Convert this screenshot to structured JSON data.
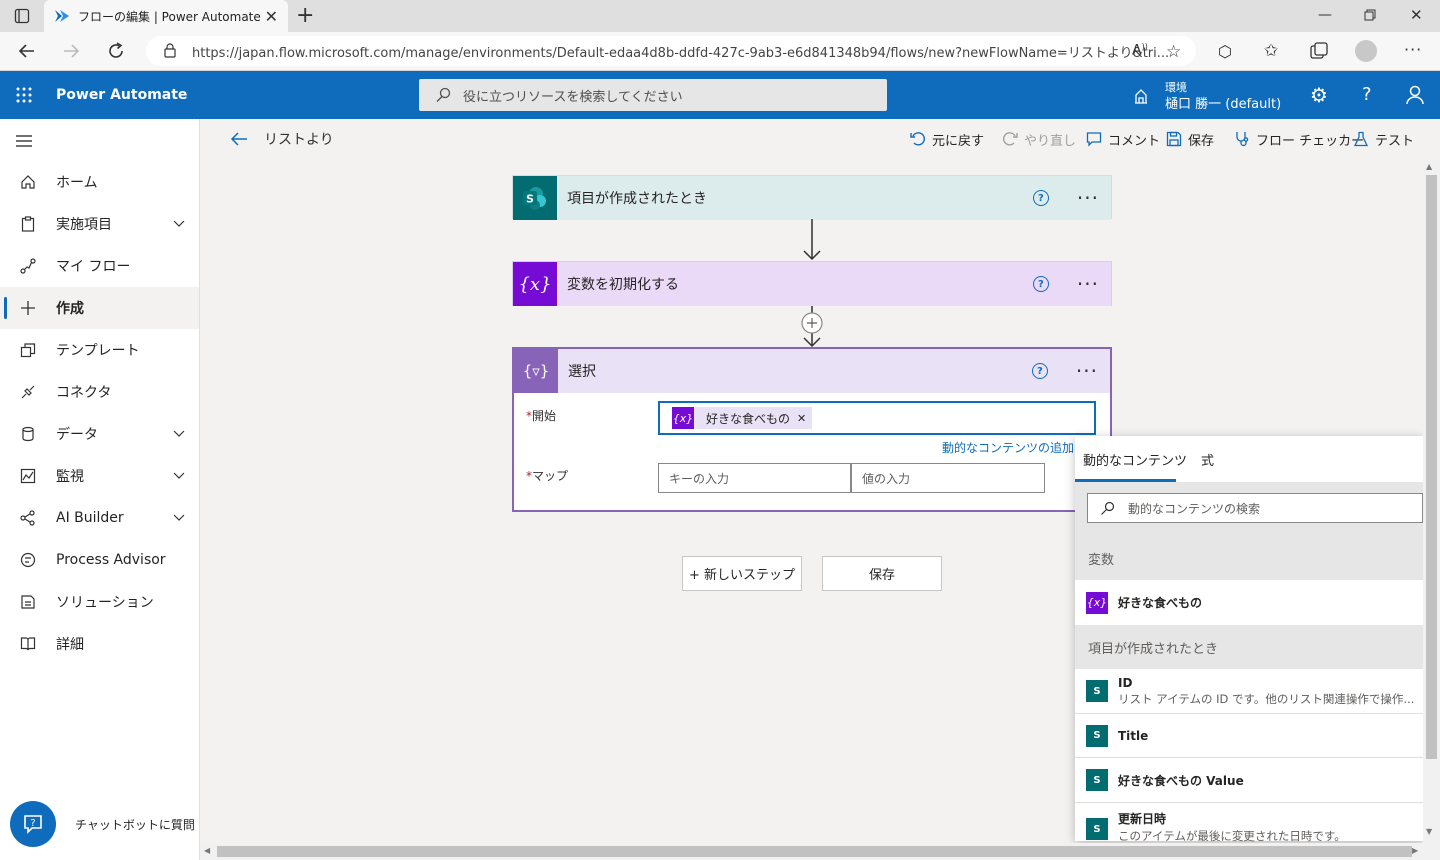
{
  "browser": {
    "tab_title": "フローの編集 | Power Automate",
    "url": "https://japan.flow.microsoft.com/manage/environments/Default-edaa4d8b-ddfd-427c-9ab3-e6d841348b94/flows/new?newFlowName=リストより&tri..."
  },
  "app": {
    "title": "Power Automate",
    "search_placeholder": "役に立つリソースを検索してください",
    "env_label": "環境",
    "env_name": "樋口 勝一 (default)"
  },
  "sidebar": {
    "items": [
      {
        "label": "ホーム",
        "icon": "home-icon"
      },
      {
        "label": "実施項目",
        "icon": "clipboard-icon",
        "chevron": true
      },
      {
        "label": "マイ フロー",
        "icon": "flow-icon"
      },
      {
        "label": "作成",
        "icon": "plus-icon",
        "active": true
      },
      {
        "label": "テンプレート",
        "icon": "template-icon"
      },
      {
        "label": "コネクタ",
        "icon": "connector-icon"
      },
      {
        "label": "データ",
        "icon": "database-icon",
        "chevron": true
      },
      {
        "label": "監視",
        "icon": "chart-icon",
        "chevron": true
      },
      {
        "label": "AI Builder",
        "icon": "ai-icon",
        "chevron": true
      },
      {
        "label": "Process Advisor",
        "icon": "process-icon"
      },
      {
        "label": "ソリューション",
        "icon": "solution-icon"
      },
      {
        "label": "詳細",
        "icon": "book-icon"
      }
    ],
    "chatbot_label": "チャットボットに質問"
  },
  "cmdbar": {
    "flow_name": "リストより",
    "undo": "元に戻す",
    "redo": "やり直し",
    "comment": "コメント",
    "save": "保存",
    "checker": "フロー チェッカー",
    "test": "テスト"
  },
  "cards": {
    "trigger_title": "項目が作成されたとき",
    "init_title": "変数を初期化する",
    "select_title": "選択",
    "from_label": "開始",
    "from_token": "好きな食べもの",
    "add_dynamic": "動的なコンテンツの追加",
    "map_label": "マップ",
    "key_placeholder": "キーの入力",
    "value_placeholder": "値の入力"
  },
  "buttons": {
    "new_step": "+ 新しいステップ",
    "save": "保存"
  },
  "dynamic_panel": {
    "tab_dynamic": "動的なコンテンツ",
    "tab_expression": "式",
    "search_placeholder": "動的なコンテンツの検索",
    "section_vars": "変数",
    "var_item": "好きな食べもの",
    "section_trigger": "項目が作成されたとき",
    "items": [
      {
        "title": "ID",
        "desc": "リスト アイテムの ID です。他のリスト関連操作で操作..."
      },
      {
        "title": "Title",
        "desc": ""
      },
      {
        "title": "好きな食べもの Value",
        "desc": ""
      },
      {
        "title": "更新日時",
        "desc": "このアイテムが最後に変更された日時です。"
      }
    ]
  },
  "colors": {
    "brand": "#0f6cbd",
    "sharepoint": "#036c70",
    "variable": "#770bd6",
    "select": "#8764b8"
  }
}
